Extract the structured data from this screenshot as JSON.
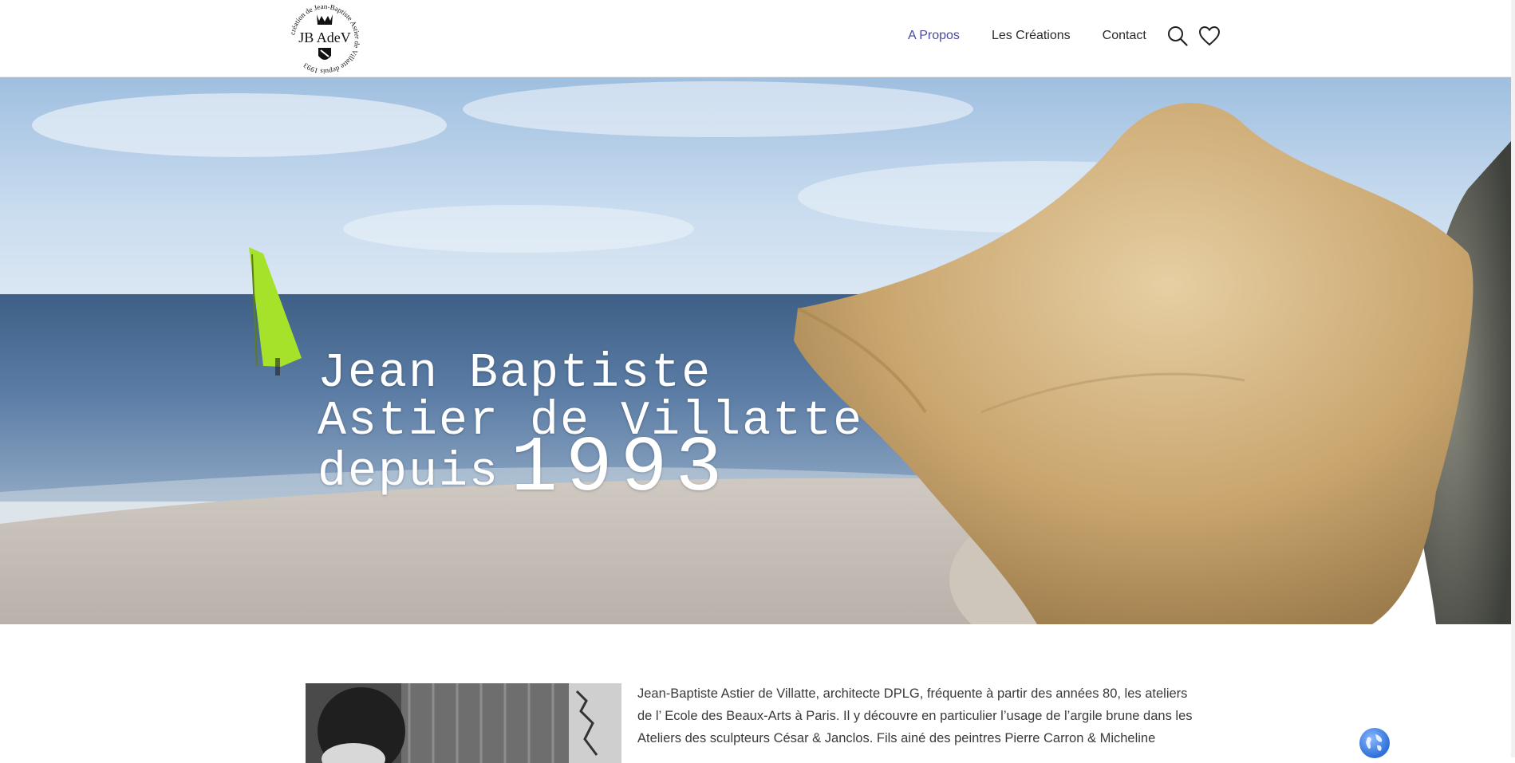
{
  "logo": {
    "center": "JB AdeV",
    "ring_text": "création de Jean-Baptiste Astier de Villatte depuis 1993"
  },
  "nav": {
    "items": [
      {
        "label": "A Propos",
        "active": true
      },
      {
        "label": "Les Créations",
        "active": false
      },
      {
        "label": "Contact",
        "active": false
      }
    ],
    "active_color": "#4b4a9e"
  },
  "icons": {
    "search": "search-icon",
    "wishlist": "heart-icon",
    "language": "globe-icon"
  },
  "hero": {
    "line1": "Jean Baptiste",
    "line2": "Astier de Villatte",
    "line3": "depuis",
    "year": "1993"
  },
  "bio": {
    "text": "Jean-Baptiste Astier de Villatte, architecte DPLG, fréquente à partir des années 80, les ateliers de l’ Ecole des Beaux-Arts à Paris. Il y découvre en particulier l’usage de l’argile brune dans les Ateliers des sculpteurs César & Janclos. Fils ainé des peintres Pierre Carron & Micheline"
  }
}
